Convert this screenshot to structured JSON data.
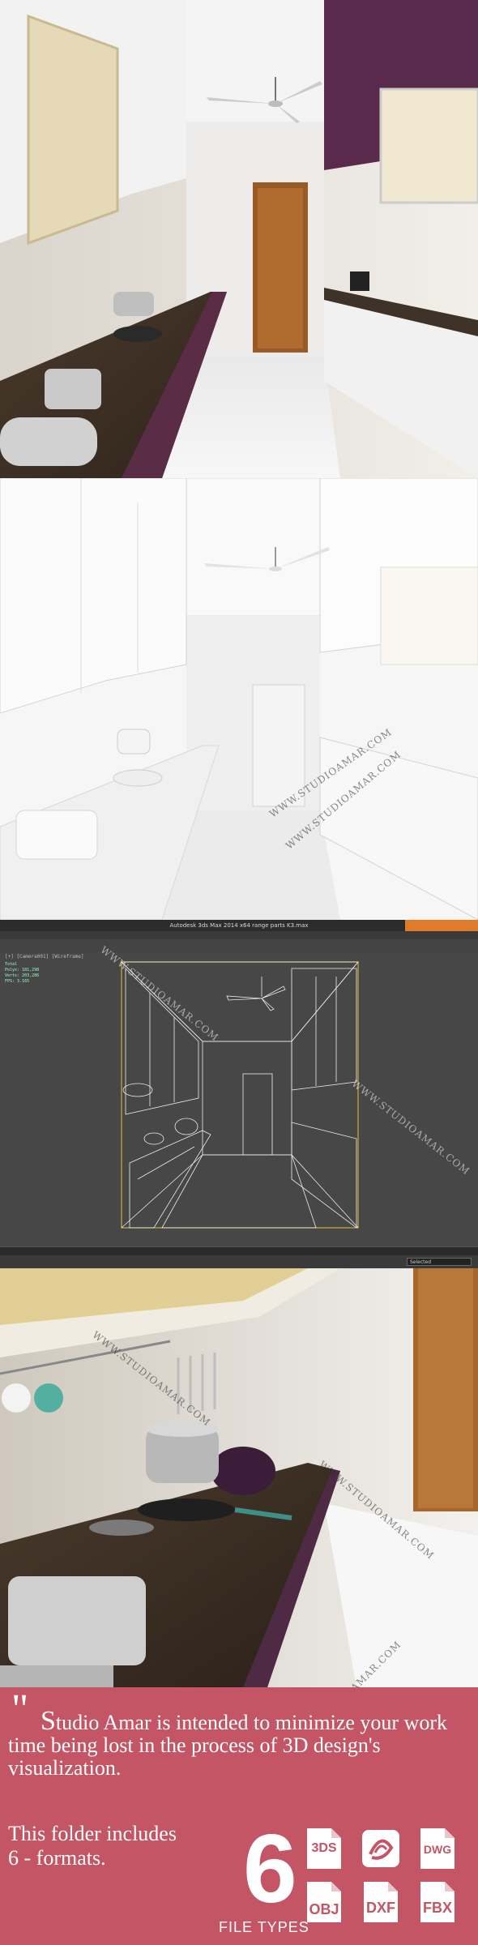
{
  "watermark": "WWW.STUDIOAMAR.COM",
  "render_panel": {
    "content": "Photorealistic kitchen render: wall cabinets on the left, hob and dark granite counter, ceiling fan, wooden door at the end"
  },
  "clay_panel": {
    "content": "White clay render of the same kitchen"
  },
  "max_panel": {
    "content": "3ds Max viewport, wireframe of the kitchen on a dark grey background",
    "window_title": "Autodesk 3ds Max 2014 x64     range parts K3.max",
    "viewport_label": "[+] [Camera001] [Wireframe]",
    "stats": [
      "Total",
      "Polys: 181,298",
      "Verts: 203,286",
      "",
      "FPS: 3.165"
    ],
    "status_field": "Selected"
  },
  "closeup_panel": {
    "content": "Close-up render: cooker on the hob, mugs hanging on the rail, toaster on the counter"
  },
  "promo": {
    "quote_mark": "\"",
    "lead_letter": "S",
    "text_rest": "tudio Amar is intended to minimize your work time being lost in the process of 3D design's visualization.",
    "folder_line1": "This folder includes",
    "folder_line2": "6 - formats.",
    "big_number": "6",
    "file_types_label": "FILE TYPES",
    "background": "#c45565",
    "formats": [
      "3DS",
      "DWG",
      "OBJ",
      "DXF",
      "FBX"
    ],
    "max_icon": "3ds-max-logo-icon"
  }
}
